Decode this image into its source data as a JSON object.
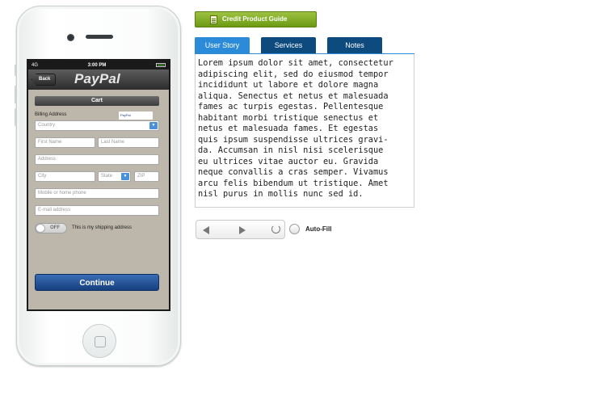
{
  "guide_button": {
    "label": "Credit Product Guide",
    "icon": "document-icon"
  },
  "tabs": [
    {
      "label": "User Story",
      "active": true
    },
    {
      "label": "Services",
      "active": false
    },
    {
      "label": "Notes",
      "active": false
    }
  ],
  "user_story_text": "Lorem ipsum dolor sit amet, consectetur\nadipiscing elit, sed do eiusmod tempor\nincididunt ut labore et dolore magna\naliqua. Senectus et netus et malesuada\nfames ac turpis egestas. Pellentesque\nhabitant morbi tristique senectus et\nnetus et malesuada fames. Et egestas\nquis ipsum suspendisse ultrices gravi-\nda. Accumsan in nisl nisi scelerisque\neu ultrices vitae auctor eu. Gravida\nneque convallis a cras semper. Vivamus\narcu felis bibendum ut tristique. Amet\nnisl purus in mollis nunc sed id.",
  "controls": {
    "back_icon": "triangle-left-icon",
    "forward_icon": "triangle-right-icon",
    "reload_icon": "reload-icon",
    "autofill_label": "Auto-Fill"
  },
  "phone": {
    "status": {
      "carrier": "4G",
      "time": "3:00 PM"
    },
    "nav": {
      "back_label": "Back",
      "logo": "PayPal"
    },
    "cart_title": "Cart",
    "billing_label": "Billing Address",
    "badge_text": "PayPal",
    "fields": {
      "country": "Country",
      "first_name": "First Name",
      "last_name": "Last Name",
      "address": "Address",
      "city": "City",
      "state": "State",
      "zip": "ZIP",
      "phone": "Mobile or home phone",
      "email": "E-mail address"
    },
    "toggle_label": "OFF",
    "shipping_label": "This is my shipping address",
    "continue_label": "Continue"
  },
  "colors": {
    "tab_active": "#2b8bd8",
    "tab_inactive": "#0d4a7e",
    "guide_green": "#7fa81f",
    "continue_blue": "#1f4f97"
  }
}
